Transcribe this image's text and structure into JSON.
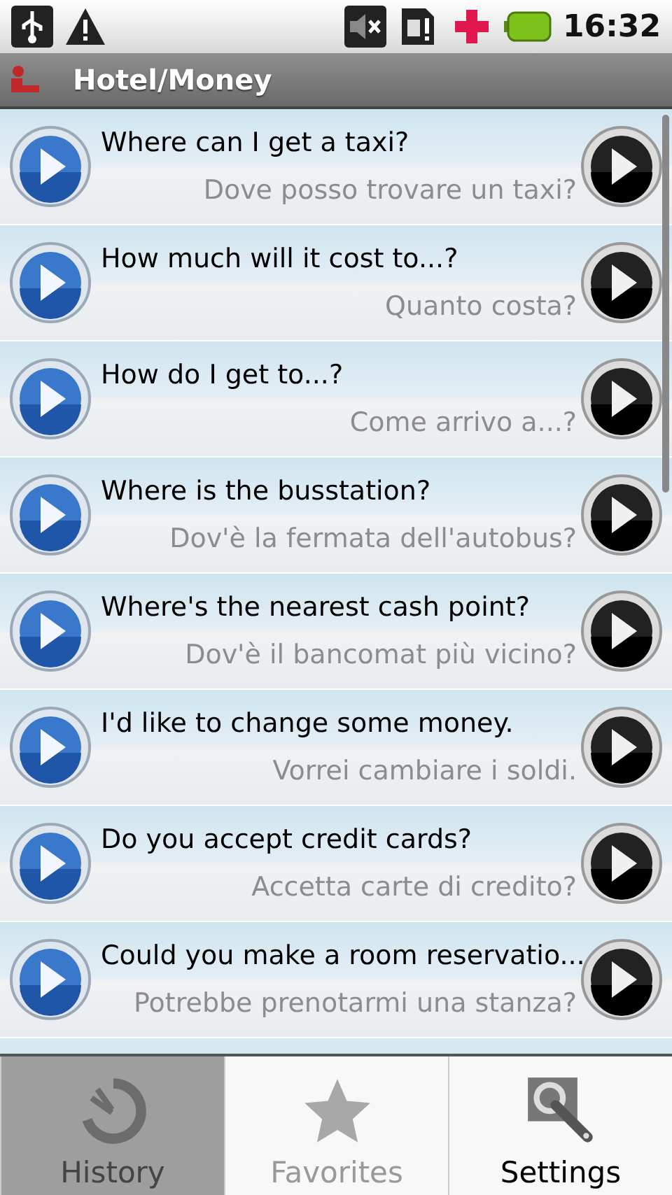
{
  "status_bar": {
    "time": "16:32"
  },
  "title_bar": {
    "title": "Hotel/Money"
  },
  "phrases": [
    {
      "english": "Where can I get a taxi?",
      "italian": "Dove posso trovare un taxi?"
    },
    {
      "english": "How much will it cost to...?",
      "italian": "Quanto costa?"
    },
    {
      "english": "How do I get to...?",
      "italian": "Come arrivo a...?"
    },
    {
      "english": "Where is the busstation?",
      "italian": "Dov'è la fermata dell'autobus?"
    },
    {
      "english": "Where's the nearest cash point?",
      "italian": "Dov'è il bancomat più vicino?"
    },
    {
      "english": "I'd like to change some money.",
      "italian": "Vorrei cambiare i soldi."
    },
    {
      "english": "Do you accept credit cards?",
      "italian": "Accetta carte di credito?"
    },
    {
      "english": "Could you make a room reservatio...",
      "italian": "Potrebbe prenotarmi una stanza?"
    }
  ],
  "menu": [
    {
      "kind": "history",
      "label": "History",
      "selected": true,
      "disabled": false
    },
    {
      "kind": "favorites",
      "label": "Favorites",
      "selected": false,
      "disabled": true
    },
    {
      "kind": "settings",
      "label": "Settings",
      "selected": false,
      "disabled": false
    }
  ]
}
